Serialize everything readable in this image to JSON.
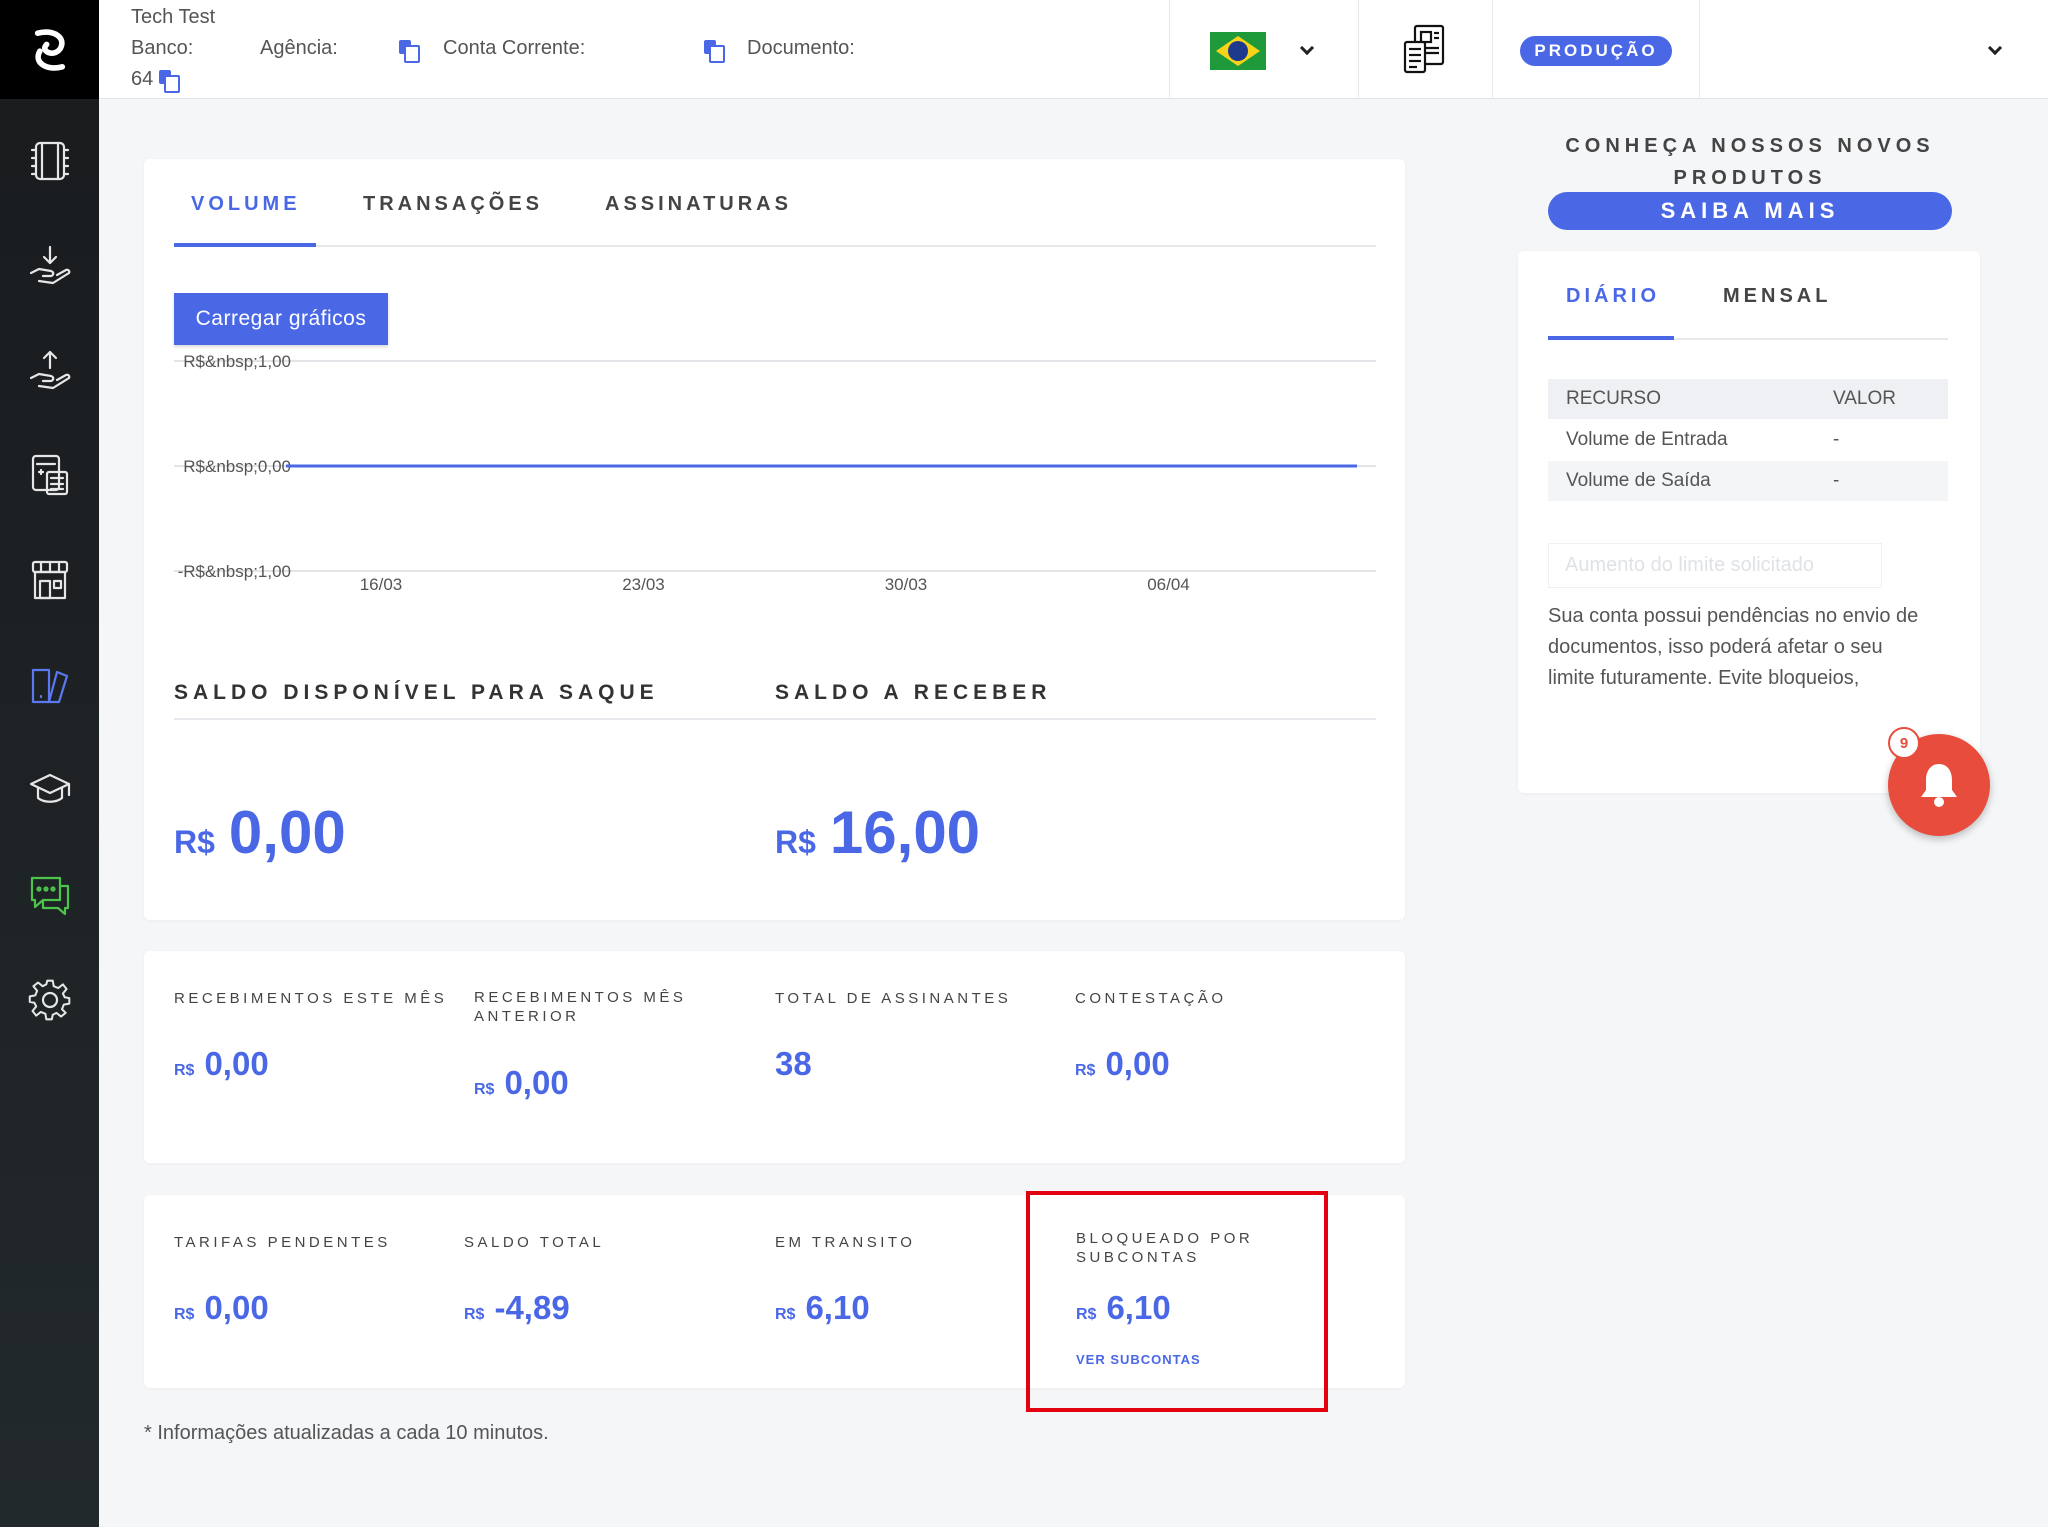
{
  "header": {
    "account_name": "Tech Test",
    "banco_label": "Banco:",
    "agencia_label": "Agência:",
    "conta_label": "Conta Corrente:",
    "documento_label": "Documento:",
    "banco_number": "64",
    "environment_badge": "PRODUÇÃO",
    "language_flag": "brazil-flag-icon"
  },
  "sidebar": {
    "items": [
      {
        "name": "extract-icon"
      },
      {
        "name": "receive-icon"
      },
      {
        "name": "send-icon"
      },
      {
        "name": "calculator-icon"
      },
      {
        "name": "store-icon"
      },
      {
        "name": "dashboard-icon",
        "active": true
      },
      {
        "name": "graduation-cap-icon"
      },
      {
        "name": "chat-icon"
      },
      {
        "name": "gear-icon"
      }
    ]
  },
  "main": {
    "tabs": [
      {
        "label": "VOLUME",
        "active": true
      },
      {
        "label": "TRANSAÇÕES",
        "active": false
      },
      {
        "label": "ASSINATURAS",
        "active": false
      }
    ],
    "load_charts_label": "Carregar gráficos",
    "saldo_disponivel_title": "SALDO DISPONÍVEL PARA SAQUE",
    "saldo_receber_title": "SALDO A RECEBER",
    "currency": "R$",
    "saldo_disponivel_value": "0,00",
    "saldo_receber_value": "16,00",
    "stats_row1": [
      {
        "label": "RECEBIMENTOS ESTE MÊS",
        "currency": "R$",
        "value": "0,00"
      },
      {
        "label": "RECEBIMENTOS MÊS ANTERIOR",
        "currency": "R$",
        "value": "0,00"
      },
      {
        "label": "TOTAL DE ASSINANTES",
        "currency": "",
        "value": "38"
      },
      {
        "label": "CONTESTAÇÃO",
        "currency": "R$",
        "value": "0,00"
      }
    ],
    "stats_row2": [
      {
        "label": "TARIFAS PENDENTES",
        "currency": "R$",
        "value": "0,00"
      },
      {
        "label": "SALDO TOTAL",
        "currency": "R$",
        "value": "-4,89"
      },
      {
        "label": "EM TRANSITO",
        "currency": "R$",
        "value": "6,10"
      },
      {
        "label": "BLOQUEADO POR SUBCONTAS",
        "currency": "R$",
        "value": "6,10"
      }
    ],
    "ver_subcontas_label": "VER SUBCONTAS",
    "footnote": "* Informações atualizadas a cada 10 minutos."
  },
  "chart_data": {
    "type": "line",
    "x": [
      "16/03",
      "23/03",
      "30/03",
      "06/04"
    ],
    "series": [
      {
        "values": [
          0,
          0,
          0,
          0
        ]
      }
    ],
    "yticks": [
      "R$&nbsp;1,00",
      "R$&nbsp;0,00",
      "-R$&nbsp;1,00"
    ],
    "ylim": [
      -1,
      1
    ],
    "grid": true,
    "line_color": "#4a68e6"
  },
  "right_panel": {
    "promo_title": "CONHEÇA NOSSOS NOVOS PRODUTOS",
    "saiba_mais_label": "SAIBA MAIS",
    "tabs": [
      {
        "label": "DIÁRIO",
        "active": true
      },
      {
        "label": "MENSAL",
        "active": false
      }
    ],
    "table": {
      "headers": [
        "RECURSO",
        "VALOR"
      ],
      "rows": [
        [
          "Volume de Entrada",
          "-"
        ],
        [
          "Volume de Saída",
          "-"
        ]
      ]
    },
    "limit_button_label": "Aumento do limite solicitado",
    "pending_text": "Sua conta possui pendências no envio de documentos, isso poderá afetar o seu limite futuramente. Evite bloqueios,"
  },
  "notifications": {
    "count": "9"
  },
  "colors": {
    "accent": "#4a68e6",
    "danger": "#e74c3c",
    "highlight": "#e3000f",
    "sidebar_bg": "#1b1e20"
  }
}
